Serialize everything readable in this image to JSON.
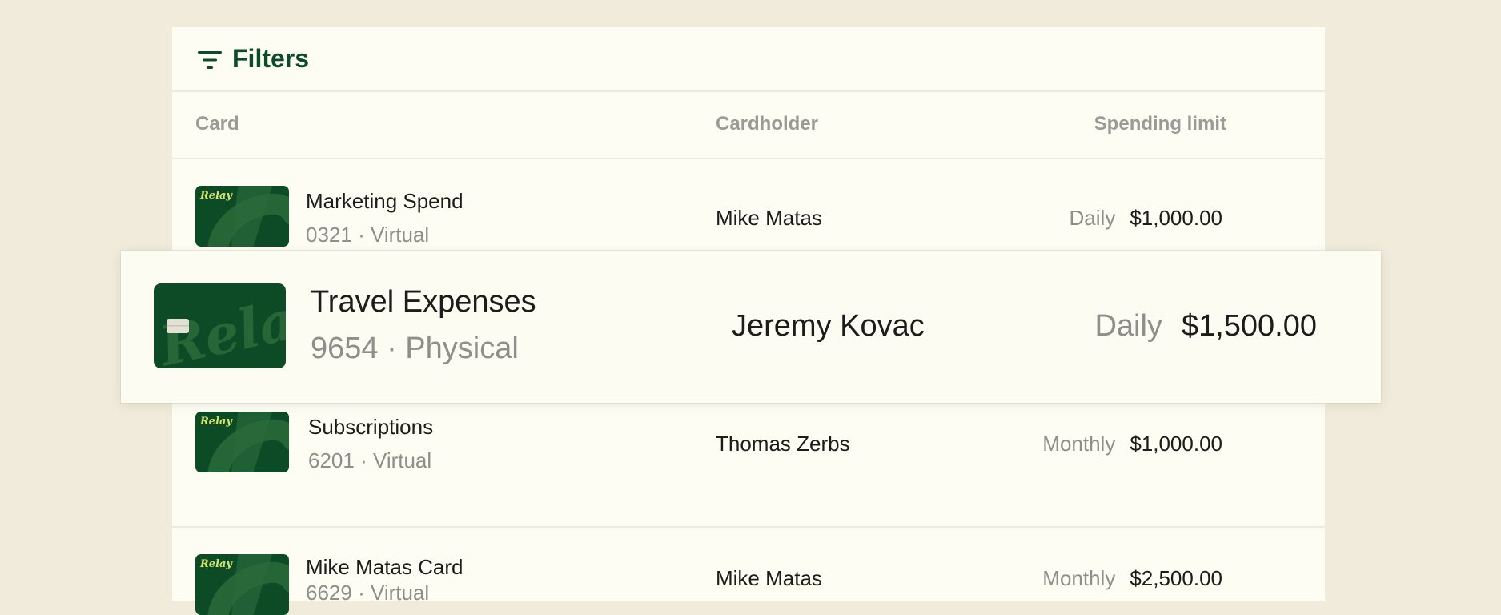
{
  "filters": {
    "label": "Filters",
    "icon": "filter-icon"
  },
  "columns": {
    "card": "Card",
    "cardholder": "Cardholder",
    "spending_limit": "Spending limit"
  },
  "card_logo_text": "Relay",
  "colors": {
    "background": "#f0ebdb",
    "panel": "#fdfdf4",
    "brand_green": "#0d4b26",
    "logo_yellow": "#d7e36a"
  },
  "rows": [
    {
      "name": "Marketing Spend",
      "sub": "0321 · Virtual",
      "holder": "Mike Matas",
      "period": "Daily",
      "amount": "$1,000.00"
    },
    {
      "name": "Travel Expenses",
      "sub": "9654 · Physical",
      "holder": "Jeremy Kovac",
      "period": "Daily",
      "amount": "$1,500.00"
    },
    {
      "name": "Subscriptions",
      "sub": "6201 · Virtual",
      "holder": "Thomas Zerbs",
      "period": "Monthly",
      "amount": "$1,000.00"
    },
    {
      "name": "Mike Matas Card",
      "sub": "6629 · Virtual",
      "holder": "Mike Matas",
      "period": "Monthly",
      "amount": "$2,500.00"
    }
  ]
}
